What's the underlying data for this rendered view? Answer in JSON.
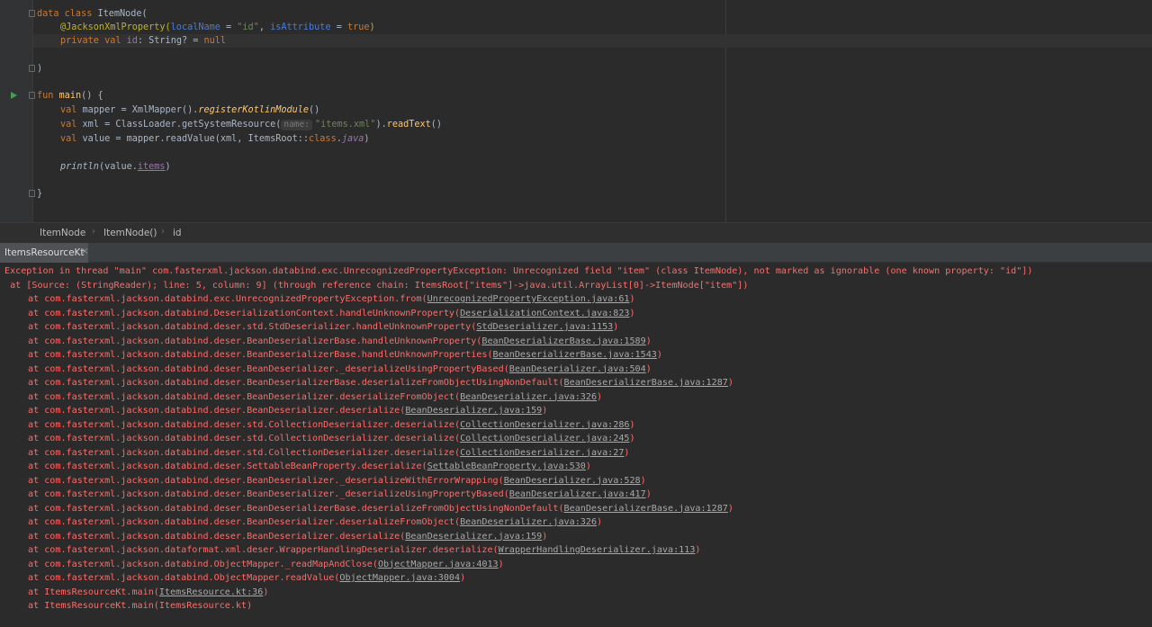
{
  "colors": {
    "editor_bg": "#2b2b2b",
    "gutter_bg": "#313335",
    "keyword": "#cc7832",
    "annotation": "#bbb529",
    "string": "#6a8759",
    "function": "#ffc66d",
    "property": "#9876aa",
    "error_text": "#ff6b68",
    "link_text": "#a9a9a9",
    "run_icon": "#499c54"
  },
  "editor": {
    "line1": {
      "kw": "data class ",
      "name": "ItemNode("
    },
    "line2": {
      "annotation": "@JacksonXmlProperty(",
      "p1": "localName",
      "eq1": " = ",
      "s1": "\"id\"",
      "comma": ", ",
      "p2": "isAttribute",
      "eq2": " = ",
      "v2": "true",
      "close": ")"
    },
    "line3": {
      "kw": "private val ",
      "name": "id",
      "type": ": String? = ",
      "null": "null"
    },
    "line5": {
      "text": ")"
    },
    "line7": {
      "kw": "fun ",
      "name": "main",
      "rest": "() {"
    },
    "line8": {
      "kw": "val ",
      "a": "mapper = XmlMapper().",
      "ext": "registerKotlinModule",
      "b": "()"
    },
    "line9": {
      "kw": "val ",
      "a": "xml = ClassLoader.getSystemResource(",
      "hint": "name:",
      "s": "\"items.xml\"",
      "b": ").",
      "ext": "readText",
      "c": "()"
    },
    "line10": {
      "kw": "val ",
      "a": "value = mapper.readValue(xml, ItemsRoot::",
      "kw2": "class",
      "dot": ".",
      "java": "java",
      "b": ")"
    },
    "line12": {
      "fn": "println",
      "a": "(value.",
      "field": "items",
      "b": ")"
    },
    "line14": {
      "text": "}"
    }
  },
  "breadcrumb": {
    "items": [
      "ItemNode",
      "ItemNode()",
      "id"
    ]
  },
  "run_tab": {
    "label": "ItemsResourceKt",
    "close": "×"
  },
  "console": {
    "exception": "Exception in thread \"main\" com.fasterxml.jackson.databind.exc.UnrecognizedPropertyException: Unrecognized field \"item\" (class ItemNode), not marked as ignorable (one known property: \"id\"])",
    "source": " at [Source: (StringReader); line: 5, column: 9] (through reference chain: ItemsRoot[\"items\"]->java.util.ArrayList[0]->ItemNode[\"item\"])",
    "frames": [
      {
        "method": "com.fasterxml.jackson.databind.exc.UnrecognizedPropertyException.from",
        "location": "UnrecognizedPropertyException.java:61"
      },
      {
        "method": "com.fasterxml.jackson.databind.DeserializationContext.handleUnknownProperty",
        "location": "DeserializationContext.java:823"
      },
      {
        "method": "com.fasterxml.jackson.databind.deser.std.StdDeserializer.handleUnknownProperty",
        "location": "StdDeserializer.java:1153"
      },
      {
        "method": "com.fasterxml.jackson.databind.deser.BeanDeserializerBase.handleUnknownProperty",
        "location": "BeanDeserializerBase.java:1589"
      },
      {
        "method": "com.fasterxml.jackson.databind.deser.BeanDeserializerBase.handleUnknownProperties",
        "location": "BeanDeserializerBase.java:1543"
      },
      {
        "method": "com.fasterxml.jackson.databind.deser.BeanDeserializer._deserializeUsingPropertyBased",
        "location": "BeanDeserializer.java:504"
      },
      {
        "method": "com.fasterxml.jackson.databind.deser.BeanDeserializerBase.deserializeFromObjectUsingNonDefault",
        "location": "BeanDeserializerBase.java:1287"
      },
      {
        "method": "com.fasterxml.jackson.databind.deser.BeanDeserializer.deserializeFromObject",
        "location": "BeanDeserializer.java:326"
      },
      {
        "method": "com.fasterxml.jackson.databind.deser.BeanDeserializer.deserialize",
        "location": "BeanDeserializer.java:159"
      },
      {
        "method": "com.fasterxml.jackson.databind.deser.std.CollectionDeserializer.deserialize",
        "location": "CollectionDeserializer.java:286"
      },
      {
        "method": "com.fasterxml.jackson.databind.deser.std.CollectionDeserializer.deserialize",
        "location": "CollectionDeserializer.java:245"
      },
      {
        "method": "com.fasterxml.jackson.databind.deser.std.CollectionDeserializer.deserialize",
        "location": "CollectionDeserializer.java:27"
      },
      {
        "method": "com.fasterxml.jackson.databind.deser.SettableBeanProperty.deserialize",
        "location": "SettableBeanProperty.java:530"
      },
      {
        "method": "com.fasterxml.jackson.databind.deser.BeanDeserializer._deserializeWithErrorWrapping",
        "location": "BeanDeserializer.java:528"
      },
      {
        "method": "com.fasterxml.jackson.databind.deser.BeanDeserializer._deserializeUsingPropertyBased",
        "location": "BeanDeserializer.java:417"
      },
      {
        "method": "com.fasterxml.jackson.databind.deser.BeanDeserializerBase.deserializeFromObjectUsingNonDefault",
        "location": "BeanDeserializerBase.java:1287"
      },
      {
        "method": "com.fasterxml.jackson.databind.deser.BeanDeserializer.deserializeFromObject",
        "location": "BeanDeserializer.java:326"
      },
      {
        "method": "com.fasterxml.jackson.databind.deser.BeanDeserializer.deserialize",
        "location": "BeanDeserializer.java:159"
      },
      {
        "method": "com.fasterxml.jackson.dataformat.xml.deser.WrapperHandlingDeserializer.deserialize",
        "location": "WrapperHandlingDeserializer.java:113"
      },
      {
        "method": "com.fasterxml.jackson.databind.ObjectMapper._readMapAndClose",
        "location": "ObjectMapper.java:4013"
      },
      {
        "method": "com.fasterxml.jackson.databind.ObjectMapper.readValue",
        "location": "ObjectMapper.java:3004"
      },
      {
        "method": "ItemsResourceKt.main",
        "location": "ItemsResource.kt:36"
      },
      {
        "method": "ItemsResourceKt.main",
        "location": "ItemsResource.kt",
        "plain": true
      }
    ]
  }
}
